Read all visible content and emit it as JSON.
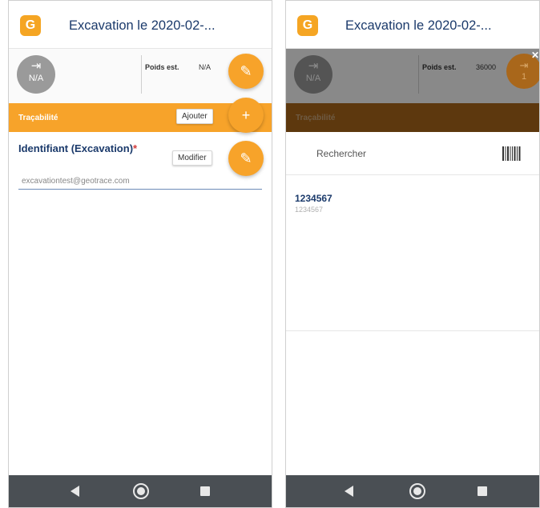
{
  "brand_color": "#f7a32a",
  "app": {
    "title": "Excavation le 2020-02-...",
    "logo_icon": "geotrace-logo-icon"
  },
  "info": {
    "in_icon": "entry-arrow-icon",
    "in_value": "N/A",
    "weight_label": "Poids est.",
    "weight_value_screen1": "N/A",
    "weight_value_screen2": "36000",
    "out_icon": "exit-arrow-icon",
    "out_value": "1"
  },
  "section": {
    "label": "Traçabilité"
  },
  "screen1": {
    "fab_ajouter_tooltip": "Ajouter",
    "fab_modifier_tooltip": "Modifier",
    "field_label": "Identifiant (Excavation)",
    "field_required_mark": "*",
    "field_value": "excavationtest@geotrace.com"
  },
  "screen2": {
    "search_placeholder": "Rechercher",
    "barcode_icon": "barcode-icon",
    "close_icon": "close-icon",
    "result": {
      "id": "1234567",
      "subtitle": "1234567"
    }
  },
  "nav": {
    "back_icon": "back-icon",
    "home_icon": "home-icon",
    "recent_icon": "recent-apps-icon"
  }
}
